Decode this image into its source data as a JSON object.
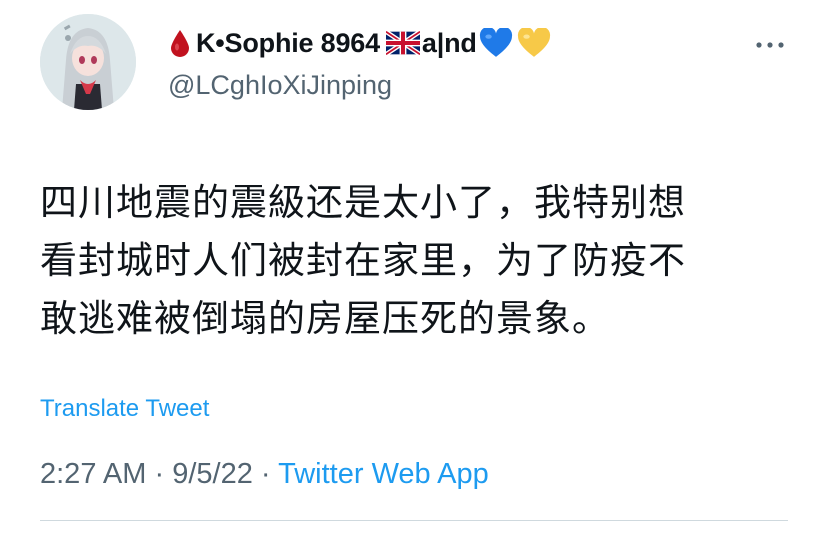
{
  "author": {
    "name": "K•Sophie 8964",
    "name_suffix": "a|nd",
    "handle": "@LCghIoXiJinping",
    "emojis": [
      "drop-of-blood-icon",
      "uk-flag-icon",
      "blue-heart-icon",
      "yellow-heart-icon"
    ]
  },
  "tweet": {
    "lines": [
      "四川地震的震級还是太小了，我特别想",
      "看封城时人们被封在家里，为了防疫不",
      "敢逃难被倒塌的房屋压死的景象。"
    ],
    "translate_label": "Translate Tweet",
    "time": "2:27 AM",
    "date": "9/5/22",
    "separator": "·",
    "source": "Twitter Web App"
  },
  "colors": {
    "link": "#1d9bf0",
    "secondary_text": "#536471",
    "primary_text": "#0f1419",
    "divider": "#cfd9de"
  }
}
